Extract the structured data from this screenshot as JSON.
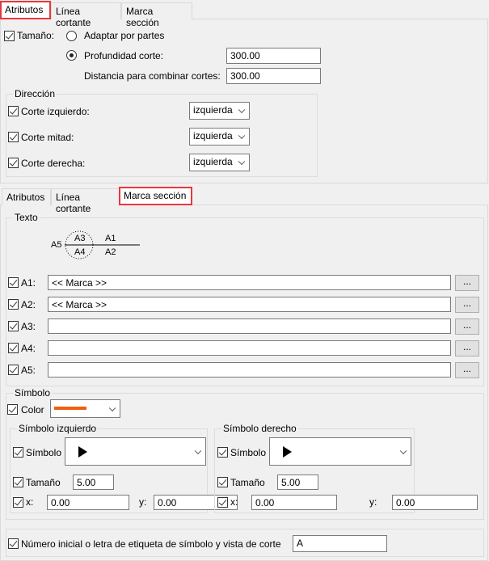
{
  "tabs": [
    "Atributos",
    "Línea cortante",
    "Marca sección"
  ],
  "atributos": {
    "tamano_label": "Tamaño:",
    "adaptar_label": "Adaptar por partes",
    "profundidad_label": "Profundidad corte:",
    "profundidad_value": "300.00",
    "distancia_label": "Distancia para combinar cortes:",
    "distancia_value": "300.00",
    "direccion": {
      "title": "Dirección",
      "rows": [
        {
          "label": "Corte izquierdo:",
          "value": "izquierda"
        },
        {
          "label": "Corte mitad:",
          "value": "izquierda"
        },
        {
          "label": "Corte derecha:",
          "value": "izquierda"
        }
      ]
    }
  },
  "marca": {
    "texto_title": "Texto",
    "diagram": {
      "a1": "A1",
      "a2": "A2",
      "a3": "A3",
      "a4": "A4",
      "a5": "A5"
    },
    "rows": [
      {
        "label": "A1:",
        "value": "<< Marca >>"
      },
      {
        "label": "A2:",
        "value": "<< Marca >>"
      },
      {
        "label": "A3:",
        "value": ""
      },
      {
        "label": "A4:",
        "value": ""
      },
      {
        "label": "A5:",
        "value": ""
      }
    ],
    "browse": "...",
    "simbolo_title": "Símbolo",
    "color_label": "Color",
    "color_value": "#f06010",
    "left": {
      "title": "Símbolo izquierdo",
      "simbolo": "Símbolo",
      "tamano": "Tamaño",
      "tamano_value": "5.00",
      "x": "x:",
      "x_value": "0.00",
      "y": "y:",
      "y_value": "0.00"
    },
    "right": {
      "title": "Símbolo derecho",
      "simbolo": "Símbolo",
      "tamano": "Tamaño",
      "tamano_value": "5.00",
      "x": "x:",
      "x_value": "0.00",
      "y": "y:",
      "y_value": "0.00"
    },
    "numero_label": "Número inicial o letra de etiqueta de símbolo y vista de corte",
    "numero_value": "A"
  }
}
